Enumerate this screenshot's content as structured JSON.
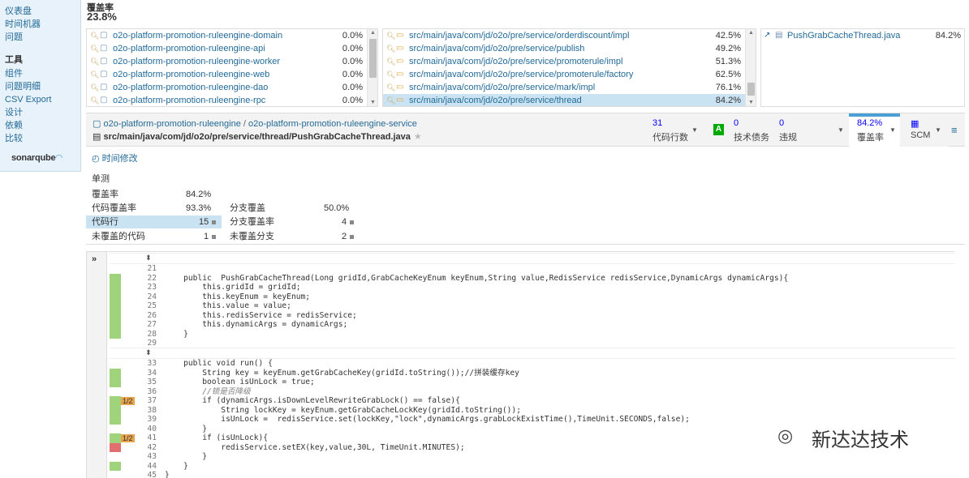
{
  "sidebar": {
    "nav": [
      "仪表盘",
      "时间机器",
      "问题"
    ],
    "tools_heading": "工具",
    "tools": [
      "组件",
      "问题明细",
      "CSV Export",
      "设计",
      "依赖",
      "比较"
    ],
    "logo": "sonarqube"
  },
  "coverage_header": {
    "title": "覆盖率",
    "total": "23.8%"
  },
  "modules": [
    {
      "name": "o2o-platform-promotion-ruleengine-domain",
      "value": "0.0%"
    },
    {
      "name": "o2o-platform-promotion-ruleengine-api",
      "value": "0.0%"
    },
    {
      "name": "o2o-platform-promotion-ruleengine-worker",
      "value": "0.0%"
    },
    {
      "name": "o2o-platform-promotion-ruleengine-web",
      "value": "0.0%"
    },
    {
      "name": "o2o-platform-promotion-ruleengine-dao",
      "value": "0.0%"
    },
    {
      "name": "o2o-platform-promotion-ruleengine-rpc",
      "value": "0.0%"
    }
  ],
  "packages": [
    {
      "name": "src/main/java/com/jd/o2o/pre/service/orderdiscount/impl",
      "value": "42.5%"
    },
    {
      "name": "src/main/java/com/jd/o2o/pre/service/publish",
      "value": "49.2%"
    },
    {
      "name": "src/main/java/com/jd/o2o/pre/service/promoterule/impl",
      "value": "51.3%"
    },
    {
      "name": "src/main/java/com/jd/o2o/pre/service/promoterule/factory",
      "value": "62.5%"
    },
    {
      "name": "src/main/java/com/jd/o2o/pre/service/mark/impl",
      "value": "76.1%"
    },
    {
      "name": "src/main/java/com/jd/o2o/pre/service/thread",
      "value": "84.2%",
      "selected": true
    }
  ],
  "files": [
    {
      "name": "PushGrabCacheThread.java",
      "value": "84.2%"
    }
  ],
  "source_header": {
    "crumb_project": "o2o-platform-promotion-ruleengine",
    "crumb_sep": "/",
    "crumb_module": "o2o-platform-promotion-ruleengine-service",
    "file_path": "src/main/java/com/jd/o2o/pre/service/thread/PushGrabCacheThread.java",
    "star": "★",
    "loc_value": "31",
    "loc_label": "代码行数",
    "grade": "A",
    "debt_value": "0",
    "debt_label": "技术债务",
    "issues_value": "0",
    "issues_label": "违规",
    "coverage_value": "84.2%",
    "coverage_label": "覆盖率",
    "scm_label": "SCM"
  },
  "time_change": "时间修改",
  "stats": {
    "unit_test": "单测",
    "coverage_label": "覆盖率",
    "coverage_value": "84.2%",
    "line_cov_label": "代码覆盖率",
    "line_cov_value": "93.3%",
    "branch_cov_label": "分支覆盖",
    "branch_cov_value": "50.0%",
    "lines_label": "代码行",
    "lines_value": "15",
    "branch_rate_label": "分支覆盖率",
    "branch_rate_value": "4",
    "uncovered_lines_label": "未覆盖的代码",
    "uncovered_lines_value": "1",
    "uncovered_branch_label": "未覆盖分支",
    "uncovered_branch_value": "2"
  },
  "expand_label": "»",
  "code_lines": {
    "l21": {
      "n": "21",
      "s": ""
    },
    "l22": {
      "n": "22",
      "s": "    public  PushGrabCacheThread(Long gridId,GrabCacheKeyEnum keyEnum,String value,RedisService redisService,DynamicArgs dynamicArgs){"
    },
    "l23": {
      "n": "23",
      "s": "        this.gridId = gridId;"
    },
    "l24": {
      "n": "24",
      "s": "        this.keyEnum = keyEnum;"
    },
    "l25": {
      "n": "25",
      "s": "        this.value = value;"
    },
    "l26": {
      "n": "26",
      "s": "        this.redisService = redisService;"
    },
    "l27": {
      "n": "27",
      "s": "        this.dynamicArgs = dynamicArgs;"
    },
    "l28": {
      "n": "28",
      "s": "    }"
    },
    "l29": {
      "n": "29",
      "s": ""
    },
    "l33": {
      "n": "33",
      "s": "    public void run() {"
    },
    "l34": {
      "n": "34",
      "s": "        String key = keyEnum.getGrabCacheKey(gridId.toString());//拼装缓存key"
    },
    "l35": {
      "n": "35",
      "s": "        boolean isUnLock = true;"
    },
    "l36": {
      "n": "36",
      "s": "        //锁是否降级"
    },
    "l37": {
      "n": "37",
      "s": "        if (dynamicArgs.isDownLevelRewriteGrabLock() == false){"
    },
    "l38": {
      "n": "38",
      "s": "            String lockKey = keyEnum.getGrabCacheLockKey(gridId.toString());"
    },
    "l39": {
      "n": "39",
      "s": "            isUnLock =  redisService.set(lockKey,\"lock\",dynamicArgs.grabLockExistTime(),TimeUnit.SECONDS,false);"
    },
    "l40": {
      "n": "40",
      "s": "        }"
    },
    "l41": {
      "n": "41",
      "s": "        if (isUnLock){"
    },
    "l42": {
      "n": "42",
      "s": "            redisService.setEX(key,value,30L, TimeUnit.MINUTES);"
    },
    "l43": {
      "n": "43",
      "s": "        }"
    },
    "l44": {
      "n": "44",
      "s": "    }"
    },
    "l45": {
      "n": "45",
      "s": "}"
    },
    "branch_37": "1/2",
    "branch_41": "1/2"
  },
  "watermark": "新达达技术"
}
